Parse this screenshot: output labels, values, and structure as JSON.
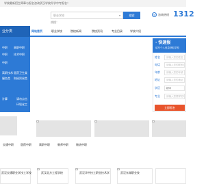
{
  "top_notice": "学校最新招生简章与报名咨询武汉学校升学中专报名！",
  "search": {
    "placeholder": "职业学校",
    "button": "搜索",
    "hot_label": "热搜："
  },
  "hotline": {
    "label": "咨询热线",
    "number": "1312"
  },
  "sidebar": {
    "title": "业分类",
    "links": [
      {
        "left": "中职",
        "right": "高职中职"
      },
      {
        "left": "中职",
        "right": "技术中职"
      },
      {
        "left": "中职",
        "right": ""
      },
      {
        "left": "",
        "right": ""
      },
      {
        "left": "",
        "right": ""
      },
      {
        "left": "高职技术",
        "right": "医药卫生类"
      },
      {
        "left": "服务类",
        "right": "财经贸易类"
      },
      {
        "left": "",
        "right": ""
      },
      {
        "left": "计算",
        "right": "请勿点击"
      },
      {
        "left": "",
        "right": "环境化工"
      }
    ]
  },
  "nav": {
    "items": [
      "网站首页",
      "职业学校",
      "院校新闻",
      "院校资讯",
      "专业目录",
      "学校介绍"
    ],
    "active_index": 0
  },
  "form": {
    "title": "· 快速报",
    "subtitle": "填写个人信息获取学校",
    "fields": [
      {
        "label": "姓名",
        "value": "请输入您的姓名"
      },
      {
        "label": "电话",
        "value": "请输入您的联系电话"
      },
      {
        "label": "年龄",
        "value": "请输入您的年龄"
      },
      {
        "label": "地址",
        "value": "请输入您的地址"
      },
      {
        "label": "学历",
        "value": "初中"
      },
      {
        "label": "专业",
        "value": "请输入您想学的专业"
      }
    ],
    "submit": "立即报名"
  },
  "categories": [
    "交通中职",
    "医药中职",
    "高职中职",
    "教师中职",
    "物流中职"
  ],
  "cards": [
    "武汉交通职业学技工学校",
    "武汉北方工程学校",
    "武汉华中技工职业技术学",
    "武汉东湖职业技"
  ]
}
